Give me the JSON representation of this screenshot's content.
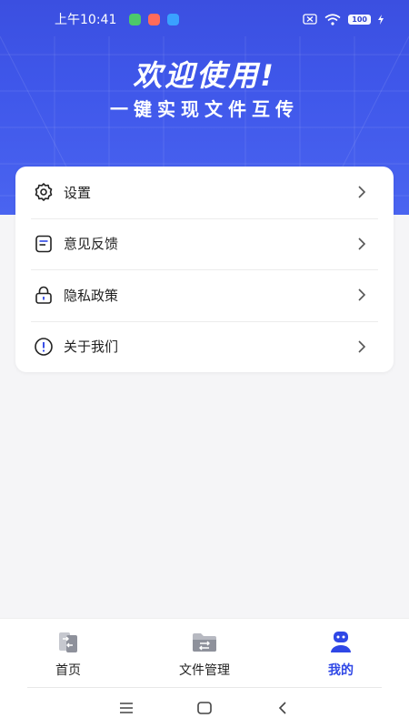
{
  "status": {
    "time": "上午10:41",
    "battery": "100",
    "notif_colors": [
      "#4cc96a",
      "#ff6b5b",
      "#3aa1ff"
    ]
  },
  "hero": {
    "title": "欢迎使用!",
    "subtitle": "一键实现文件互传",
    "color_top": "#3b4fe0",
    "color_bottom": "#4a64f0"
  },
  "menu": {
    "items": [
      {
        "label": "设置",
        "icon": "gear-icon"
      },
      {
        "label": "意见反馈",
        "icon": "feedback-icon"
      },
      {
        "label": "隐私政策",
        "icon": "lock-icon"
      },
      {
        "label": "关于我们",
        "icon": "info-icon"
      }
    ]
  },
  "tabbar": {
    "tabs": [
      {
        "label": "首页",
        "icon": "phone-transfer-icon",
        "active": false
      },
      {
        "label": "文件管理",
        "icon": "folder-icon",
        "active": false
      },
      {
        "label": "我的",
        "icon": "profile-icon",
        "active": true
      }
    ],
    "active_color": "#2f47e6"
  },
  "sysnav": {
    "buttons": [
      "menu-icon",
      "home-icon",
      "back-icon"
    ]
  }
}
